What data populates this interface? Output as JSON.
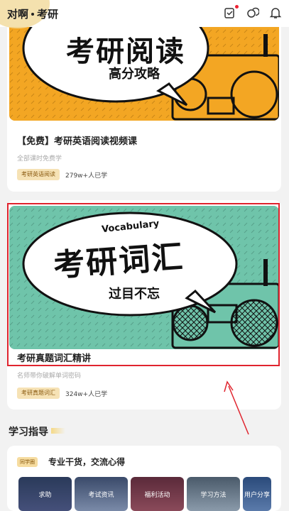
{
  "header": {
    "brand": "对啊",
    "title": "考研"
  },
  "icons": {
    "checklist": "checklist-icon",
    "coins": "coins-icon",
    "bell": "bell-icon"
  },
  "card1": {
    "banner_main": "考研阅读",
    "banner_sub": "高分攻略",
    "title": "【免费】考研英语阅读视频课",
    "subtitle": "全部课时免费学",
    "tag": "考研英语阅读",
    "learners": "279w+人已学"
  },
  "card2": {
    "banner_top": "Vocabulary",
    "banner_main": "考研词汇",
    "banner_sub": "过目不忘",
    "title": "考研真题词汇精讲",
    "subtitle": "名师带你破解单词密码",
    "tag": "考研真题词汇",
    "learners": "324w+人已学"
  },
  "guide": {
    "section_title": "学习指导",
    "badge": "同学圈",
    "title": "专业干货，交流心得",
    "tiles": [
      "求助",
      "考试资讯",
      "福利活动",
      "学习方法",
      "用户分享"
    ]
  },
  "colors": {
    "accent_red": "#e0242e",
    "banner_orange": "#f3a623",
    "banner_teal": "#6fc4aa"
  }
}
